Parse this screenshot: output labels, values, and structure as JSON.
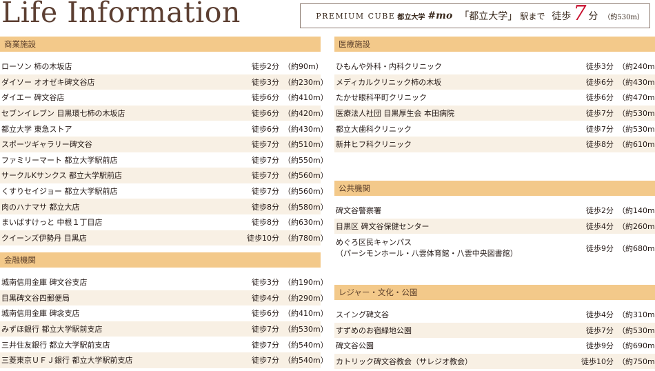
{
  "title": "Life Information",
  "station": {
    "brand": "PREMIUM CUBE",
    "station_small": "都立大学",
    "mo": "#mo",
    "to_station": "「都立大学」",
    "to_suffix": "駅まで",
    "walk": "徒歩",
    "minutes": "7",
    "unit": "分",
    "approx": "（約530m）"
  },
  "sections": {
    "commercial": {
      "title": "商業施設",
      "items": [
        {
          "name": "ローソン 柿の木坂店",
          "walk": "徒歩2分",
          "dist": "（約90m）"
        },
        {
          "name": "ダイソー オオゼキ碑文谷店",
          "walk": "徒歩3分",
          "dist": "（約230m）"
        },
        {
          "name": "ダイエー 碑文谷店",
          "walk": "徒歩6分",
          "dist": "（約410m）"
        },
        {
          "name": "セブンイレブン 目黒環七柿の木坂店",
          "walk": "徒歩6分",
          "dist": "（約420m）"
        },
        {
          "name": "都立大学 東急ストア",
          "walk": "徒歩6分",
          "dist": "（約430m）"
        },
        {
          "name": "スポーツギャラリー碑文谷",
          "walk": "徒歩7分",
          "dist": "（約510m）"
        },
        {
          "name": "ファミリーマート 都立大学駅前店",
          "walk": "徒歩7分",
          "dist": "（約550m）"
        },
        {
          "name": "サークルKサンクス 都立大学駅前店",
          "walk": "徒歩7分",
          "dist": "（約560m）"
        },
        {
          "name": "くすりセイジョー 都立大学駅前店",
          "walk": "徒歩7分",
          "dist": "（約560m）"
        },
        {
          "name": "肉のハナマサ 都立大店",
          "walk": "徒歩8分",
          "dist": "（約580m）"
        },
        {
          "name": "まいばすけっと 中根１丁目店",
          "walk": "徒歩8分",
          "dist": "（約630m）"
        },
        {
          "name": "クイーンズ伊勢丹 目黒店",
          "walk": "徒歩10分",
          "dist": "（約780m）"
        }
      ]
    },
    "finance": {
      "title": "金融機関",
      "items": [
        {
          "name": "城南信用金庫 碑文谷支店",
          "walk": "徒歩3分",
          "dist": "（約190m）"
        },
        {
          "name": "目黒碑文谷四郵便局",
          "walk": "徒歩4分",
          "dist": "（約290m）"
        },
        {
          "name": "城南信用金庫 碑衾支店",
          "walk": "徒歩6分",
          "dist": "（約410m）"
        },
        {
          "name": "みずほ銀行 都立大学駅前支店",
          "walk": "徒歩7分",
          "dist": "（約530m）"
        },
        {
          "name": "三井住友銀行 都立大学駅前支店",
          "walk": "徒歩7分",
          "dist": "（約540m）"
        },
        {
          "name": "三菱東京ＵＦＪ銀行 都立大学駅前支店",
          "walk": "徒歩7分",
          "dist": "（約540m）"
        }
      ]
    },
    "medical": {
      "title": "医療施設",
      "items": [
        {
          "name": "ひもんや外科・内科クリニック",
          "walk": "徒歩3分",
          "dist": "（約240m）"
        },
        {
          "name": "メディカルクリニック柿の木坂",
          "walk": "徒歩6分",
          "dist": "（約430m）"
        },
        {
          "name": "たかせ眼科平町クリニック",
          "walk": "徒歩6分",
          "dist": "（約470m）"
        },
        {
          "name": "医療法人社団 目黒厚生会 本田病院",
          "walk": "徒歩7分",
          "dist": "（約530m）"
        },
        {
          "name": "都立大歯科クリニック",
          "walk": "徒歩7分",
          "dist": "（約530m）"
        },
        {
          "name": "新井ヒフ科クリニック",
          "walk": "徒歩8分",
          "dist": "（約610m）"
        }
      ]
    },
    "public": {
      "title": "公共機関",
      "items": [
        {
          "name": "碑文谷警察署",
          "walk": "徒歩2分",
          "dist": "（約140m）"
        },
        {
          "name": "目黒区 碑文谷保健センター",
          "walk": "徒歩4分",
          "dist": "（約260m）"
        },
        {
          "name": "めぐろ区民キャンパス\n（パーシモンホール・八雲体育館・八雲中央図書館）",
          "walk": "徒歩9分",
          "dist": "（約680m）"
        }
      ]
    },
    "leisure": {
      "title": "レジャー・文化・公園",
      "items": [
        {
          "name": "スイング碑文谷",
          "walk": "徒歩4分",
          "dist": "（約310m）"
        },
        {
          "name": "すずめのお宿緑地公園",
          "walk": "徒歩7分",
          "dist": "（約530m）"
        },
        {
          "name": "碑文谷公園",
          "walk": "徒歩9分",
          "dist": "（約690m）"
        },
        {
          "name": "カトリック碑文谷教会（サレジオ教会）",
          "walk": "徒歩10分",
          "dist": "（約750m）"
        }
      ]
    }
  }
}
